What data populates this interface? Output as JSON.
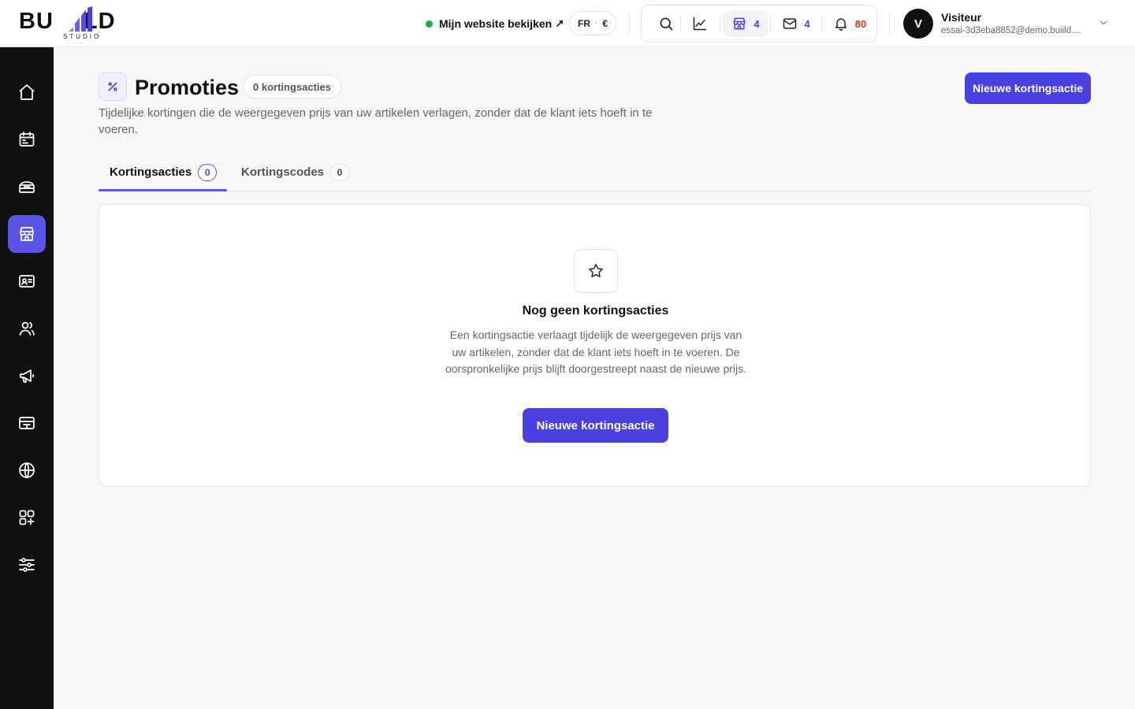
{
  "brand": {
    "word_left": "BU",
    "word_right": "LD",
    "subtitle": "STUDIO"
  },
  "header": {
    "site_link": "Mijn website bekijken ↗",
    "locale": {
      "language": "FR",
      "separator": "·",
      "currency": "€"
    },
    "tools": [
      {
        "icon": "search-icon",
        "count": ""
      },
      {
        "icon": "chart-icon",
        "count": ""
      },
      {
        "icon": "store-icon",
        "count": "4",
        "color": "#4a3fe0"
      },
      {
        "icon": "mail-icon",
        "count": "4",
        "color": "#4a3fe0"
      },
      {
        "icon": "bell-icon",
        "count": "80",
        "color": "#d93025"
      }
    ],
    "user": {
      "initial": "V",
      "name": "Visiteur",
      "email": "essai-3d3eba8852@demo.buiild...."
    }
  },
  "sidebar": {
    "items": [
      {
        "icon": "home-icon",
        "active": false
      },
      {
        "icon": "calendar-icon",
        "active": false
      },
      {
        "icon": "services-icon",
        "active": false
      },
      {
        "icon": "store-icon",
        "active": true
      },
      {
        "icon": "id-card-icon",
        "active": false
      },
      {
        "icon": "users-icon",
        "active": false
      },
      {
        "icon": "megaphone-icon",
        "active": false
      },
      {
        "icon": "payment-icon",
        "active": false
      },
      {
        "icon": "globe-icon",
        "active": false
      },
      {
        "icon": "apps-icon",
        "active": false
      },
      {
        "icon": "sliders-icon",
        "active": false
      }
    ]
  },
  "page": {
    "title": "Promoties",
    "count_badge": "0 kortingsacties",
    "description": "Tijdelijke kortingen die de weergegeven prijs van uw artikelen verlagen, zonder dat de klant iets hoeft in te voeren.",
    "primary_action": "Nieuwe kortingsactie"
  },
  "tabs": [
    {
      "label": "Kortingsacties",
      "count": "0",
      "active": true
    },
    {
      "label": "Kortingscodes",
      "count": "0",
      "active": false
    }
  ],
  "empty_state": {
    "icon": "star-icon",
    "title": "Nog geen kortingsacties",
    "description": "Een kortingsactie verlaagt tijdelijk de weergegeven prijs van uw artikelen, zonder dat de klant iets hoeft in te voeren. De oorspronkelijke prijs blijft doorgestreept naast de nieuwe prijs.",
    "action": "Nieuwe kortingsactie"
  },
  "colors": {
    "accent": "#4a3fe0",
    "sidebar_bg": "#111113",
    "status_online": "#22a846",
    "alert": "#d93025"
  }
}
